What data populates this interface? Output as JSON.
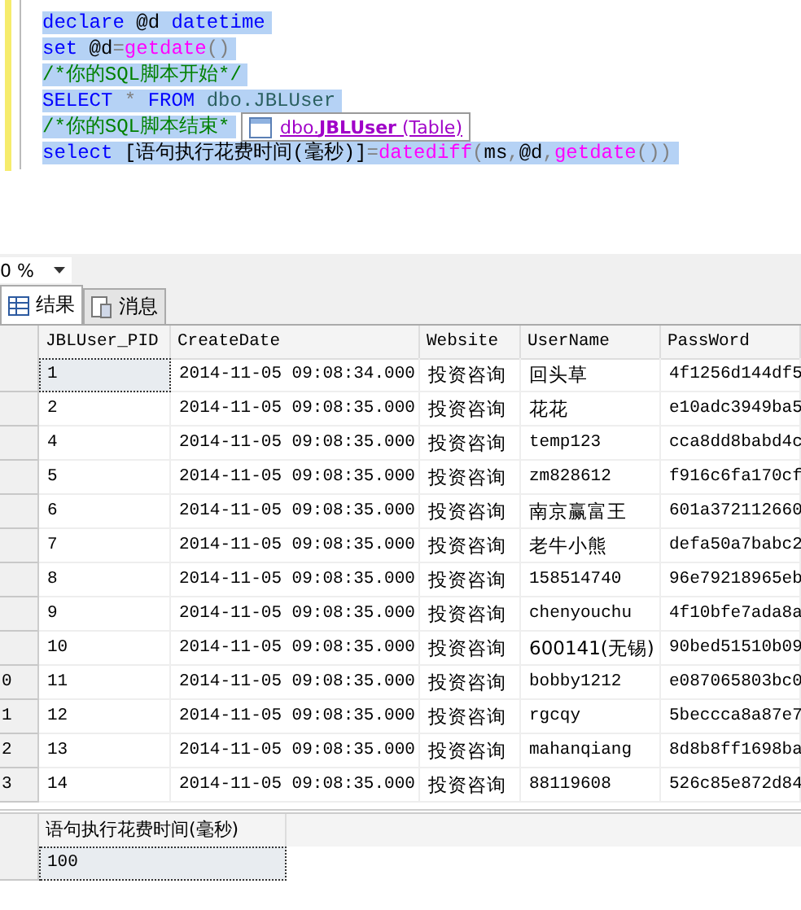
{
  "editor": {
    "lines": [
      {
        "tokens": [
          {
            "text": "declare",
            "kind": "keyword"
          },
          {
            "text": " @d ",
            "kind": "plain"
          },
          {
            "text": "datetime",
            "kind": "keyword"
          }
        ]
      },
      {
        "tokens": [
          {
            "text": "set",
            "kind": "keyword"
          },
          {
            "text": " @d",
            "kind": "plain"
          },
          {
            "text": "=",
            "kind": "operator"
          },
          {
            "text": "getdate",
            "kind": "function"
          },
          {
            "text": "()",
            "kind": "operator"
          }
        ]
      },
      {
        "tokens": [
          {
            "text": "/*你的SQL脚本开始*/",
            "kind": "comment"
          }
        ]
      },
      {
        "tokens": [
          {
            "text": "SELECT ",
            "kind": "keyword"
          },
          {
            "text": "*",
            "kind": "operator"
          },
          {
            "text": " FROM",
            "kind": "keyword"
          },
          {
            "text": " dbo.JBLUser",
            "kind": "object"
          }
        ]
      },
      {
        "tokens": [
          {
            "text": "/*你的SQL脚本结束*",
            "kind": "comment"
          }
        ]
      },
      {
        "tokens": [
          {
            "text": "select",
            "kind": "keyword"
          },
          {
            "text": " [语句执行花费时间(毫秒)]",
            "kind": "plain"
          },
          {
            "text": "=",
            "kind": "operator"
          },
          {
            "text": "datediff",
            "kind": "function"
          },
          {
            "text": "(",
            "kind": "operator"
          },
          {
            "text": "ms",
            "kind": "plain"
          },
          {
            "text": ",",
            "kind": "operator"
          },
          {
            "text": "@d",
            "kind": "plain"
          },
          {
            "text": ",",
            "kind": "operator"
          },
          {
            "text": "getdate",
            "kind": "function"
          },
          {
            "text": "())",
            "kind": "operator"
          }
        ]
      }
    ],
    "tooltip": {
      "text": "dbo.**JBLUser** (Table)"
    }
  },
  "zoom": {
    "value": "0 %"
  },
  "tabs": [
    {
      "label": "结果",
      "selected": true
    },
    {
      "label": "消息",
      "selected": false
    }
  ],
  "results": [
    {
      "columns": [
        "JBLUser_PID",
        "CreateDate",
        "Website",
        "UserName",
        "PassWord"
      ],
      "rows": [
        {
          "selected": true,
          "cells": [
            "1",
            "2014-11-05 09:08:34.000",
            "投资咨询",
            "回头草",
            "4f1256d144df5"
          ]
        },
        {
          "selected": false,
          "cells": [
            "2",
            "2014-11-05 09:08:35.000",
            "投资咨询",
            "花花",
            "e10adc3949ba5"
          ]
        },
        {
          "selected": false,
          "cells": [
            "4",
            "2014-11-05 09:08:35.000",
            "投资咨询",
            "temp123",
            "cca8dd8babd4c"
          ]
        },
        {
          "selected": false,
          "cells": [
            "5",
            "2014-11-05 09:08:35.000",
            "投资咨询",
            "zm828612",
            "f916c6fa170cf"
          ]
        },
        {
          "selected": false,
          "cells": [
            "6",
            "2014-11-05 09:08:35.000",
            "投资咨询",
            "南京赢富王",
            "601a372112660"
          ]
        },
        {
          "selected": false,
          "cells": [
            "7",
            "2014-11-05 09:08:35.000",
            "投资咨询",
            "老牛小熊",
            "defa50a7babc2"
          ]
        },
        {
          "selected": false,
          "cells": [
            "8",
            "2014-11-05 09:08:35.000",
            "投资咨询",
            "158514740",
            "96e79218965eb"
          ]
        },
        {
          "selected": false,
          "cells": [
            "9",
            "2014-11-05 09:08:35.000",
            "投资咨询",
            "chenyouchu",
            "4f10bfe7ada8a"
          ]
        },
        {
          "selected": false,
          "cells": [
            "10",
            "2014-11-05 09:08:35.000",
            "投资咨询",
            "600141(无锡)",
            "90bed51510b09"
          ]
        },
        {
          "header": "0",
          "selected": false,
          "cells": [
            "11",
            "2014-11-05 09:08:35.000",
            "投资咨询",
            "bobby1212",
            "e087065803bc0"
          ]
        },
        {
          "header": "1",
          "selected": false,
          "cells": [
            "12",
            "2014-11-05 09:08:35.000",
            "投资咨询",
            "rgcqy",
            "5beccca8a87e7"
          ]
        },
        {
          "header": "2",
          "selected": false,
          "cells": [
            "13",
            "2014-11-05 09:08:35.000",
            "投资咨询",
            "mahanqiang",
            "8d8b8ff1698ba"
          ]
        },
        {
          "header": "3",
          "selected": false,
          "cells": [
            "14",
            "2014-11-05 09:08:35.000",
            "投资咨询",
            "88119608",
            "526c85e872d84"
          ]
        }
      ]
    },
    {
      "columns": [
        "语句执行花费时间(毫秒)"
      ],
      "rows": [
        {
          "selected": true,
          "cells": [
            "100"
          ]
        }
      ]
    }
  ]
}
